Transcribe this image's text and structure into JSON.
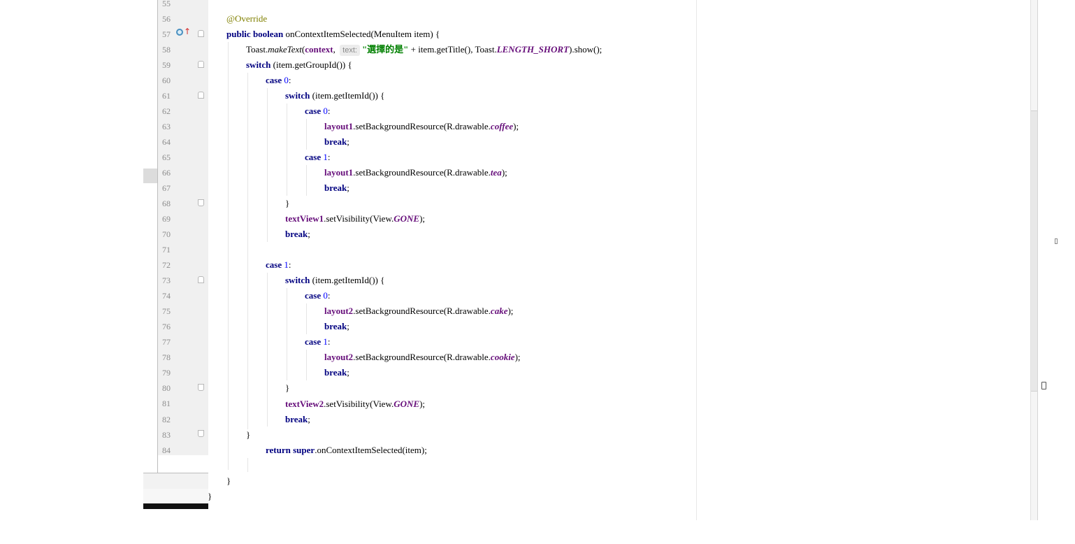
{
  "editor": {
    "line_numbers": [
      "55",
      "56",
      "57",
      "58",
      "59",
      "60",
      "61",
      "62",
      "63",
      "64",
      "65",
      "66",
      "67",
      "68",
      "69",
      "70",
      "71",
      "72",
      "73",
      "74",
      "75",
      "76",
      "77",
      "78",
      "79",
      "80",
      "81",
      "82",
      "83",
      "84"
    ],
    "gutter_icons": {
      "override_arrow": "↑"
    },
    "code": {
      "l56_annotation": "@Override",
      "l57_public": "public",
      "l57_boolean": "boolean",
      "l57_rest": " onContextItemSelected(MenuItem item) {",
      "l58_toast": "Toast.",
      "l58_maketext": "makeText",
      "l58_paren": "(",
      "l58_context": "context",
      "l58_comma": ", ",
      "l58_hint": "text:",
      "l58_string": "\"選擇的是\"",
      "l58_rest1": " + item.getTitle(), Toast.",
      "l58_lengthshort": "LENGTH_SHORT",
      "l58_rest2": ").show();",
      "l59_switch": "switch",
      "l59_rest": " (item.getGroupId()) {",
      "l60_case": "case",
      "l60_num": "0",
      "l60_colon": ":",
      "l61_switch": "switch",
      "l61_rest": " (item.getItemId()) {",
      "l62_case": "case",
      "l62_num": "0",
      "l62_colon": ":",
      "l63_field": "layout1",
      "l63_rest": ".setBackgroundResource(R.drawable.",
      "l63_res": "coffee",
      "l63_end": ");",
      "l64_break": "break",
      "l64_semi": ";",
      "l65_case": "case",
      "l65_num": "1",
      "l65_colon": ":",
      "l66_field": "layout1",
      "l66_rest": ".setBackgroundResource(R.drawable.",
      "l66_res": "tea",
      "l66_end": ");",
      "l67_break": "break",
      "l67_semi": ";",
      "l68_brace": "}",
      "l69_field": "textView1",
      "l69_rest": ".setVisibility(View.",
      "l69_const": "GONE",
      "l69_end": ");",
      "l70_break": "break",
      "l70_semi": ";",
      "l72_case": "case",
      "l72_num": "1",
      "l72_colon": ":",
      "l73_switch": "switch",
      "l73_rest": " (item.getItemId()) {",
      "l74_case": "case",
      "l74_num": "0",
      "l74_colon": ":",
      "l75_field": "layout2",
      "l75_rest": ".setBackgroundResource(R.drawable.",
      "l75_res": "cake",
      "l75_end": ");",
      "l76_break": "break",
      "l76_semi": ";",
      "l77_case": "case",
      "l77_num": "1",
      "l77_colon": ":",
      "l78_field": "layout2",
      "l78_rest": ".setBackgroundResource(R.drawable.",
      "l78_res": "cookie",
      "l78_end": ");",
      "l79_break": "break",
      "l79_semi": ";",
      "l80_brace": "}",
      "l81_field": "textView2",
      "l81_rest": ".setVisibility(View.",
      "l81_const": "GONE",
      "l81_end": ");",
      "l82_break": "break",
      "l82_semi": ";",
      "l83_brace": "}",
      "l84_return": "return",
      "l84_super": "super",
      "l84_rest": ".onContextItemSelected(item);",
      "l86_brace": "}",
      "l87_brace": "}"
    }
  }
}
